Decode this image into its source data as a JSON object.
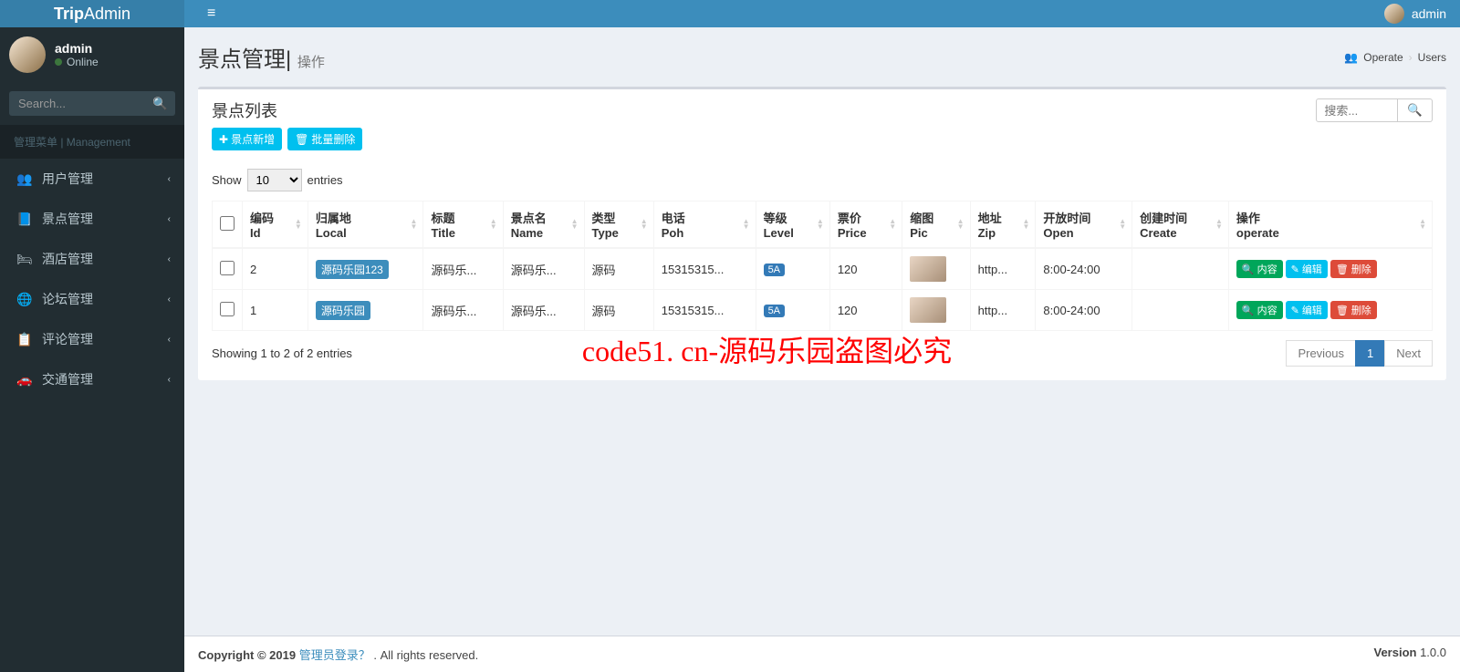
{
  "brand": {
    "bold": "Trip",
    "light": "Admin"
  },
  "topnav": {
    "username": "admin"
  },
  "sidebar": {
    "user": {
      "name": "admin",
      "status": "Online"
    },
    "search_placeholder": "Search...",
    "section_header": "管理菜单 | Management",
    "menu": [
      {
        "icon": "👥",
        "label": "用户管理"
      },
      {
        "icon": "📘",
        "label": "景点管理"
      },
      {
        "icon": "🛏",
        "label": "酒店管理"
      },
      {
        "icon": "🌐",
        "label": "论坛管理"
      },
      {
        "icon": "📋",
        "label": "评论管理"
      },
      {
        "icon": "🚗",
        "label": "交通管理"
      }
    ]
  },
  "page": {
    "title": "景点管理|",
    "subtitle": "操作",
    "breadcrumb": {
      "icon_label": "Operate",
      "current": "Users"
    }
  },
  "box": {
    "title": "景点列表",
    "search_placeholder": "搜索...",
    "add_btn": "景点新增",
    "bulk_del_btn": "批量删除"
  },
  "datatable": {
    "show_prefix": "Show",
    "show_value": "10",
    "show_suffix": "entries",
    "columns": [
      "编码|Id",
      "归属地|Local",
      "标题|Title",
      "景点名|Name",
      "类型|Type",
      "电话|Poh",
      "等级|Level",
      "票价|Price",
      "缩图|Pic",
      "地址|Zip",
      "开放时间|Open",
      "创建时间|Create",
      "操作|operate"
    ],
    "rows": [
      {
        "id": "2",
        "local": "源码乐园123",
        "title": "源码乐...",
        "name": "源码乐...",
        "type": "源码",
        "phone": "15315315...",
        "level": "5A",
        "price": "120",
        "zip": "http...",
        "open": "8:00-24:00",
        "create": ""
      },
      {
        "id": "1",
        "local": "源码乐园",
        "title": "源码乐...",
        "name": "源码乐...",
        "type": "源码",
        "phone": "15315315...",
        "level": "5A",
        "price": "120",
        "zip": "http...",
        "open": "8:00-24:00",
        "create": ""
      }
    ],
    "actions": {
      "content": "内容",
      "edit": "编辑",
      "delete": "删除"
    },
    "info": "Showing 1 to 2 of 2 entries",
    "prev": "Previous",
    "page": "1",
    "next": "Next"
  },
  "footer": {
    "copyright_prefix": "Copyright © 2019 ",
    "copyright_link": "管理员登录？",
    "copyright_suffix": " . All rights reserved.",
    "version_label": "Version ",
    "version": "1.0.0"
  },
  "watermark": "code51. cn-源码乐园盗图必究"
}
